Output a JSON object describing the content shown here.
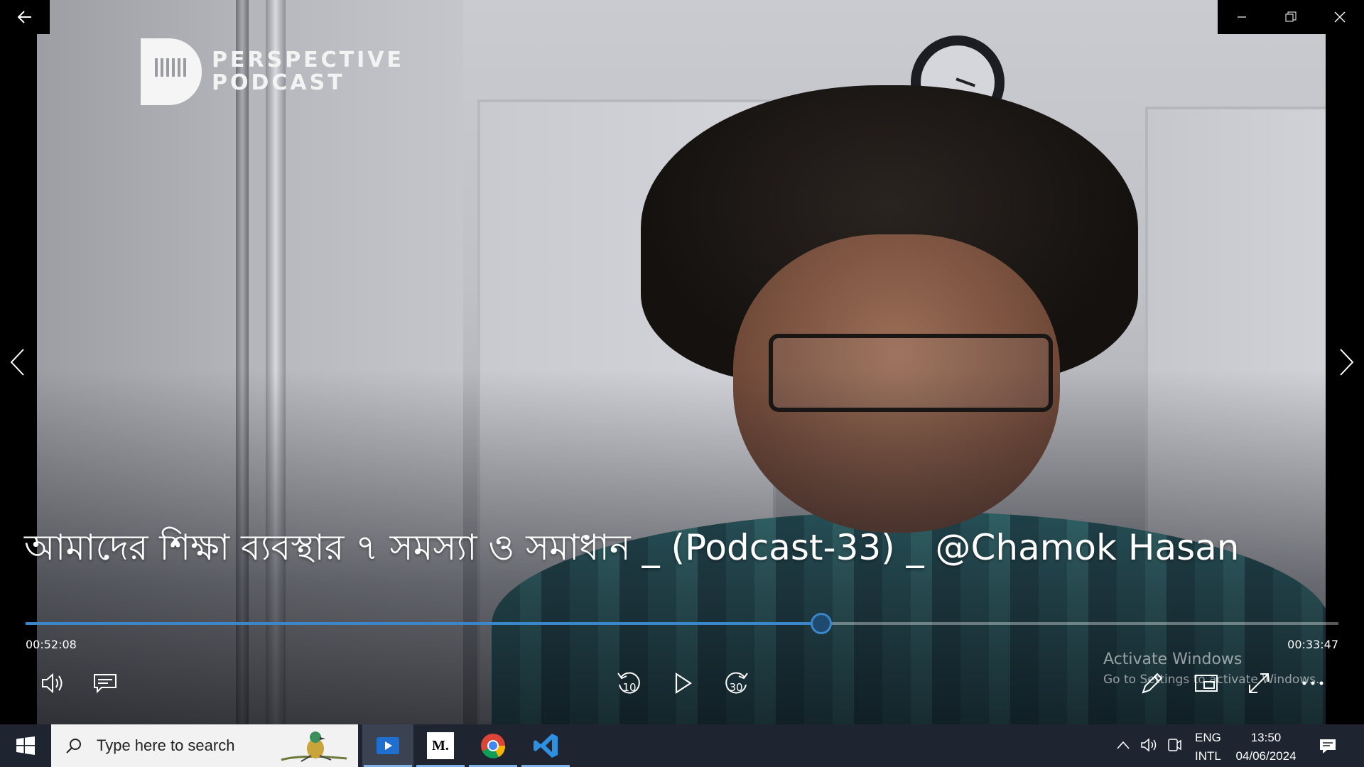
{
  "window": {
    "back_icon": "back-arrow-icon",
    "minimize_icon": "minimize-icon",
    "restore_icon": "restore-icon",
    "close_icon": "close-icon"
  },
  "overlay": {
    "logo_line1": "PERSPECTIVE",
    "logo_line2": "PODCAST"
  },
  "player": {
    "title": "আমাদের শিক্ষা ব্যবস্থার ৭ সমস্যা ও সমাধান _ (Podcast-33) _ @Chamok Hasan",
    "elapsed": "00:52:08",
    "remaining": "00:33:47",
    "progress_fraction": 0.606,
    "skip_back_label": "10",
    "skip_forward_label": "30",
    "accent_color": "#3a86c8"
  },
  "watermark": {
    "line1": "Activate Windows",
    "line2": "Go to Settings to activate Windows."
  },
  "taskbar": {
    "search_placeholder": "Type here to search",
    "apps": [
      "media-player",
      "medium",
      "chrome",
      "vscode"
    ],
    "medium_label": "M.",
    "lang_line1": "ENG",
    "lang_line2": "INTL",
    "time": "13:50",
    "date": "04/06/2024"
  }
}
